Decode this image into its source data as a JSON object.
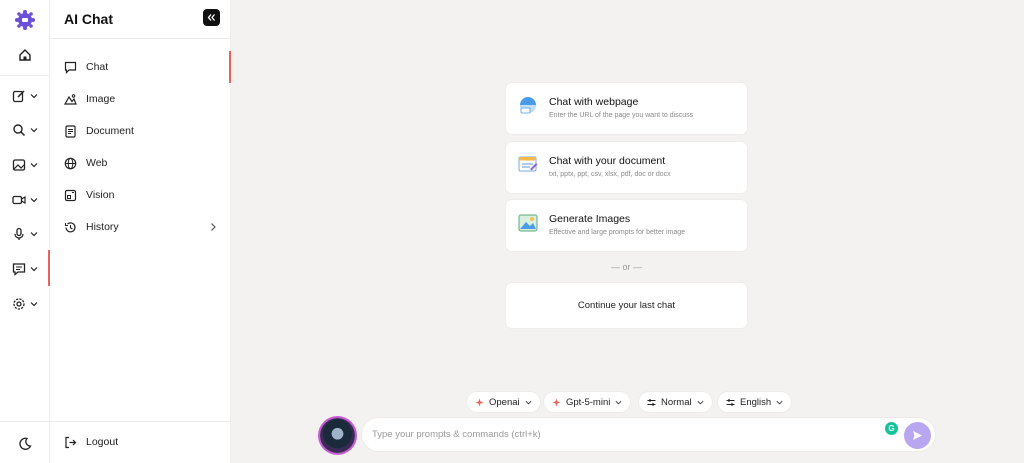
{
  "app": {
    "title": "AI Chat"
  },
  "rail": {
    "items": [
      {
        "icon": "home-icon"
      },
      {
        "icon": "edit-icon"
      },
      {
        "icon": "search-icon"
      },
      {
        "icon": "image-icon"
      },
      {
        "icon": "video-icon"
      },
      {
        "icon": "microphone-icon"
      },
      {
        "icon": "chat-icon"
      },
      {
        "icon": "settings-icon"
      }
    ],
    "theme_icon": "moon-icon"
  },
  "sidebar": {
    "items": [
      {
        "label": "Chat",
        "icon": "chat-bubble-icon",
        "active": true
      },
      {
        "label": "Image",
        "icon": "image-icon"
      },
      {
        "label": "Document",
        "icon": "document-icon"
      },
      {
        "label": "Web",
        "icon": "globe-icon"
      },
      {
        "label": "Vision",
        "icon": "vision-icon"
      },
      {
        "label": "History",
        "icon": "history-icon"
      }
    ],
    "logout_label": "Logout"
  },
  "main": {
    "cards": [
      {
        "title": "Chat with webpage",
        "subtitle": "Enter the URL of the page you want to discuss"
      },
      {
        "title": "Chat with your document",
        "subtitle": "txt, pptx, ppt, csv, xlsx, pdf, doc or docx"
      },
      {
        "title": "Generate Images",
        "subtitle": "Effective and large prompts for better image"
      }
    ],
    "or_separator": "— or —",
    "continue_label": "Continue your last chat"
  },
  "composer": {
    "chips": [
      {
        "label": "Openai"
      },
      {
        "label": "Gpt-5-mini"
      },
      {
        "label": "Normal"
      },
      {
        "label": "English"
      }
    ],
    "placeholder": "Type your prompts & commands (ctrl+k)",
    "grammarly_badge": "G"
  },
  "colors": {
    "accent": "#e8645a",
    "send": "#b9a6f0",
    "background": "#f3f2f1"
  }
}
